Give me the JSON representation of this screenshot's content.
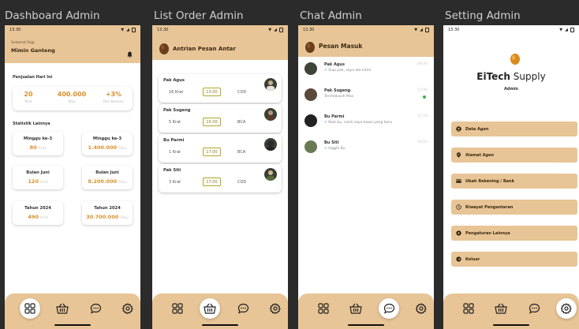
{
  "statusbar": {
    "time": "13.30"
  },
  "dashboard": {
    "panel_title": "Dashboard Admin",
    "greeting": "Selamat Pagi,",
    "user_name": "Mimin Ganteng",
    "sales_title": "Penjualan Hari Ini",
    "sales": [
      {
        "value": "20",
        "unit": "Krat"
      },
      {
        "value": "400.000",
        "unit": "Ribu"
      },
      {
        "value": "+3%",
        "unit": "Dari Kemarin"
      }
    ],
    "stats_title": "Statistik Lainnya",
    "stats": [
      {
        "title": "Minggu ke-3",
        "value": "80",
        "unit": "Krat"
      },
      {
        "title": "Minggu ke-3",
        "value": "1.400.000",
        "unit": "Ribu"
      },
      {
        "title": "Bulan Juni",
        "value": "120",
        "unit": "Krat"
      },
      {
        "title": "Bulan Juni",
        "value": "8.200.000",
        "unit": "Ribu"
      },
      {
        "title": "Tahun 2024",
        "value": "490",
        "unit": "Krat"
      },
      {
        "title": "Tahun 2024",
        "value": "30.700.000",
        "unit": "Ribu"
      }
    ]
  },
  "orders": {
    "panel_title": "List Order Admin",
    "header": "Antrian Pesan Antar",
    "items": [
      {
        "name": "Pak Agus",
        "qty": "16 Krat",
        "time": "13.00",
        "payment": "COD"
      },
      {
        "name": "Pak Sugeng",
        "qty": "5 Krat",
        "time": "15.00",
        "payment": "BCA"
      },
      {
        "name": "Bu Parmi",
        "qty": "1 Krat",
        "time": "17.00",
        "payment": "BCA"
      },
      {
        "name": "Pak Siti",
        "qty": "3 Krat",
        "time": "17.00",
        "payment": "COD"
      }
    ]
  },
  "chat": {
    "panel_title": "Chat Admin",
    "header": "Pesan Masuk",
    "items": [
      {
        "name": "Pak Agus",
        "message": "Siap pak, saya ate kirim",
        "time": "08.00",
        "read": true,
        "unread": false
      },
      {
        "name": "Pak Sugeng",
        "message": "Terimakasih Mas",
        "time": "13.00",
        "read": false,
        "unread": true
      },
      {
        "name": "Bu Parmi",
        "message": "Baik bu, nanti saya bawa yang baru",
        "time": "15.16",
        "read": true,
        "unread": false
      },
      {
        "name": "Bu Siti",
        "message": "Inggih Bu",
        "time": "18.02",
        "read": true,
        "unread": false
      }
    ]
  },
  "settings": {
    "panel_title": "Setting Admin",
    "brand_bold": "EiTech",
    "brand_light": " Supply",
    "role": "Admin",
    "menu": [
      {
        "label": "Data Agen",
        "icon": "user-icon"
      },
      {
        "label": "Alamat Agen",
        "icon": "location-pin-icon"
      },
      {
        "label": "Ubah Rekening / Bank",
        "icon": "card-icon"
      },
      {
        "label": "Riwayat Pengantaran",
        "icon": "history-icon"
      },
      {
        "label": "Pengaturan Lainnya",
        "icon": "gear-icon"
      },
      {
        "label": "Keluar",
        "icon": "logout-icon"
      }
    ]
  },
  "nav": [
    "dashboard-nav",
    "orders-nav",
    "chat-nav",
    "settings-nav"
  ]
}
